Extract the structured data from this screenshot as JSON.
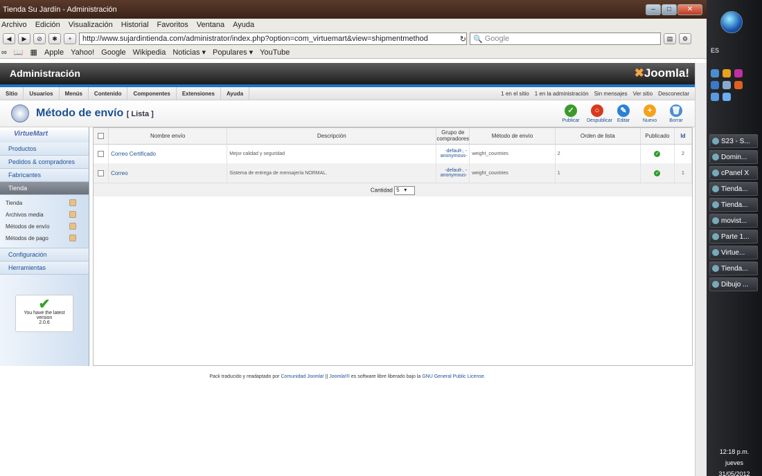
{
  "browser": {
    "title": "Tienda Su Jardín - Administración",
    "menu": [
      "Archivo",
      "Edición",
      "Visualización",
      "Historial",
      "Favoritos",
      "Ventana",
      "Ayuda"
    ],
    "url": "http://www.sujardintienda.com/administrator/index.php?option=com_virtuemart&view=shipmentmethod",
    "search_placeholder": "Google",
    "bookmarks": [
      "Apple",
      "Yahoo!",
      "Google",
      "Wikipedia",
      "Noticias ▾",
      "Populares ▾",
      "YouTube"
    ]
  },
  "joomla": {
    "admin_title": "Administración",
    "logo": "Joomla!",
    "menu": [
      "Sitio",
      "Usuarios",
      "Menús",
      "Contenido",
      "Componentes",
      "Extensiones",
      "Ayuda"
    ],
    "status": [
      "1 en el sitio",
      "1 en la administración",
      "Sin mensajes",
      "Ver sitio",
      "Desconectar"
    ]
  },
  "page": {
    "title": "Método de envío",
    "subtitle": "[ Lista ]",
    "toolbar": [
      {
        "label": "Publicar",
        "color": "#3a9a2a",
        "glyph": "✓"
      },
      {
        "label": "Despublicar",
        "color": "#d8391f",
        "glyph": "○"
      },
      {
        "label": "Editar",
        "color": "#2b82d4",
        "glyph": "✎"
      },
      {
        "label": "Nuevo",
        "color": "#f5a21b",
        "glyph": "+"
      },
      {
        "label": "Borrar",
        "color": "#4a8ed0",
        "glyph": "🗑"
      }
    ]
  },
  "sidebar": {
    "brand": "VirtueMart",
    "sections": [
      "Productos",
      "Pedidos & compradores",
      "Fabricantes",
      "Tienda"
    ],
    "subitems": [
      "Tienda",
      "Archivos media",
      "Métodos de envío",
      "Métodos de pago"
    ],
    "sections_after": [
      "Configuración",
      "Herramientas"
    ],
    "version_text": "You have the latest version",
    "version": "2.0.6"
  },
  "table": {
    "headers": [
      "Nombre envío",
      "Descripción",
      "Grupo de compradores",
      "Método de envío",
      "Orden de lista",
      "Publicado",
      "Id"
    ],
    "rows": [
      {
        "name": "Correo Certificado",
        "desc": "Mejor calidad y seguridad",
        "group": "-default-, -anonymous-",
        "method": "weight_countries",
        "order": "2",
        "id": "2"
      },
      {
        "name": "Correo",
        "desc": "Sistema de entrega de mensajería NORMAL.",
        "group": "-default-, -anonymous-",
        "method": "weight_countries",
        "order": "1",
        "id": "1"
      }
    ],
    "pagination_label": "Cantidad",
    "pagination_value": "5"
  },
  "footer": {
    "pre": "Pack traducido y readaptado por",
    "link1": "Comunidad Joomla!",
    "sep": "||",
    "link2": "Joomla!®",
    "mid": "es software libre liberado bajo la",
    "link3": "GNU General Public License."
  },
  "taskbar": {
    "lang": "ES",
    "tasks": [
      "S23 - S...",
      "Domin...",
      "cPanel X",
      "Tienda...",
      "Tienda...",
      "movist...",
      "Parte 1...",
      "Virtue...",
      "Tienda...",
      "Dibujo ..."
    ],
    "time": "12:18 p.m.",
    "day": "jueves",
    "date": "31/05/2012"
  }
}
